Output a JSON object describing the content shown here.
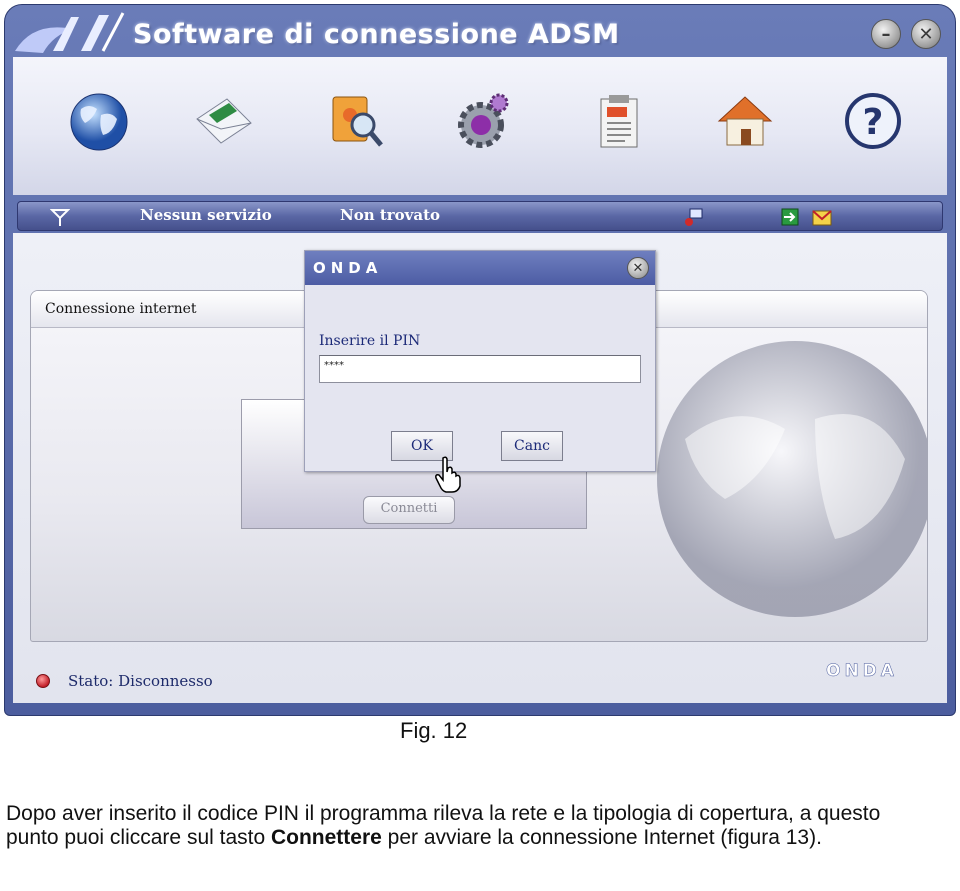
{
  "window": {
    "title": "Software di connessione ADSM"
  },
  "toolbar": {
    "icons": [
      "globe-icon",
      "mail-icon",
      "address-book-icon",
      "settings-gear-icon",
      "clipboard-icon",
      "home-icon",
      "help-icon"
    ]
  },
  "statusbar": {
    "service": "Nessun servizio",
    "network": "Non trovato"
  },
  "connection": {
    "tab_title": "Connessione internet",
    "connect_label": "Connetti",
    "status": "Stato: Disconnesso"
  },
  "dialog": {
    "brand": "ONDA",
    "pin_label": "Inserire il PIN",
    "pin_value": "****",
    "ok_label": "OK",
    "cancel_label": "Canc"
  },
  "footer": {
    "brand": "ONDA"
  },
  "caption": {
    "figure": "Fig. 12",
    "text_before": "Dopo aver inserito il codice  PIN  il programma rileva la rete e la tipologia di copertura, a questo punto puoi cliccare sul tasto ",
    "bold": "Connettere",
    "text_after": " per avviare la connessione  Internet (figura 13)."
  },
  "colors": {
    "frame": "#5566a8",
    "status_disconnected": "#c3202a",
    "label_text": "#1c2a78"
  }
}
